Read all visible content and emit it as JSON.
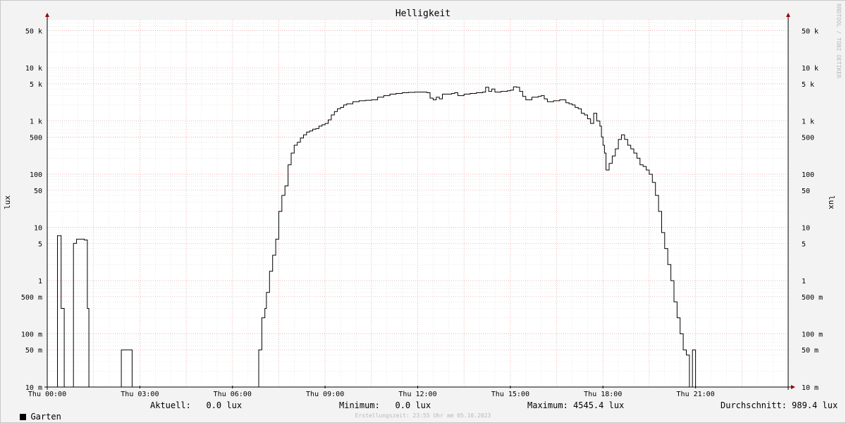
{
  "chart_data": {
    "type": "line",
    "title": "Helligkeit",
    "ylabel": "lux",
    "yscale": "log",
    "ylim": [
      0.01,
      80000
    ],
    "xlim_hours": [
      0,
      24
    ],
    "grid": true,
    "x_ticks": [
      {
        "hour": 0,
        "label": "Thu 00:00"
      },
      {
        "hour": 3,
        "label": "Thu 03:00"
      },
      {
        "hour": 6,
        "label": "Thu 06:00"
      },
      {
        "hour": 9,
        "label": "Thu 09:00"
      },
      {
        "hour": 12,
        "label": "Thu 12:00"
      },
      {
        "hour": 15,
        "label": "Thu 15:00"
      },
      {
        "hour": 18,
        "label": "Thu 18:00"
      },
      {
        "hour": 21,
        "label": "Thu 21:00"
      }
    ],
    "y_ticks": [
      {
        "value": 50000,
        "label": "50 k"
      },
      {
        "value": 10000,
        "label": "10 k"
      },
      {
        "value": 5000,
        "label": "5 k"
      },
      {
        "value": 1000,
        "label": "1 k"
      },
      {
        "value": 500,
        "label": "500"
      },
      {
        "value": 100,
        "label": "100"
      },
      {
        "value": 50,
        "label": "50"
      },
      {
        "value": 10,
        "label": "10"
      },
      {
        "value": 5,
        "label": "5"
      },
      {
        "value": 1,
        "label": "1"
      },
      {
        "value": 0.5,
        "label": "500 m"
      },
      {
        "value": 0.1,
        "label": "100 m"
      },
      {
        "value": 0.05,
        "label": "50 m"
      },
      {
        "value": 0.01,
        "label": "10 m"
      }
    ],
    "series": [
      {
        "name": "Garten",
        "color": "#000000",
        "points": [
          [
            0.0,
            0.01
          ],
          [
            0.33,
            7
          ],
          [
            0.45,
            0.3
          ],
          [
            0.55,
            0.01
          ],
          [
            0.85,
            5
          ],
          [
            0.95,
            6
          ],
          [
            1.2,
            5.8
          ],
          [
            1.3,
            0.3
          ],
          [
            1.35,
            0.01
          ],
          [
            2.4,
            0.05
          ],
          [
            2.7,
            0.05
          ],
          [
            2.75,
            0.01
          ],
          [
            6.8,
            0.01
          ],
          [
            6.85,
            0.05
          ],
          [
            6.95,
            0.2
          ],
          [
            7.05,
            0.3
          ],
          [
            7.1,
            0.6
          ],
          [
            7.2,
            1.5
          ],
          [
            7.3,
            3
          ],
          [
            7.4,
            6
          ],
          [
            7.5,
            20
          ],
          [
            7.6,
            40
          ],
          [
            7.7,
            60
          ],
          [
            7.8,
            150
          ],
          [
            7.9,
            250
          ],
          [
            8.0,
            350
          ],
          [
            8.1,
            400
          ],
          [
            8.2,
            480
          ],
          [
            8.3,
            550
          ],
          [
            8.4,
            620
          ],
          [
            8.5,
            650
          ],
          [
            8.6,
            700
          ],
          [
            8.7,
            720
          ],
          [
            8.8,
            800
          ],
          [
            8.9,
            850
          ],
          [
            9.0,
            900
          ],
          [
            9.1,
            1050
          ],
          [
            9.2,
            1300
          ],
          [
            9.3,
            1500
          ],
          [
            9.4,
            1700
          ],
          [
            9.5,
            1800
          ],
          [
            9.6,
            2000
          ],
          [
            9.7,
            2100
          ],
          [
            9.9,
            2300
          ],
          [
            10.1,
            2400
          ],
          [
            10.3,
            2450
          ],
          [
            10.5,
            2500
          ],
          [
            10.7,
            2800
          ],
          [
            10.9,
            3000
          ],
          [
            11.1,
            3200
          ],
          [
            11.3,
            3300
          ],
          [
            11.5,
            3400
          ],
          [
            11.7,
            3450
          ],
          [
            11.9,
            3500
          ],
          [
            12.1,
            3500
          ],
          [
            12.3,
            3400
          ],
          [
            12.4,
            2700
          ],
          [
            12.5,
            2500
          ],
          [
            12.6,
            2800
          ],
          [
            12.7,
            2600
          ],
          [
            12.8,
            3200
          ],
          [
            13.0,
            3200
          ],
          [
            13.1,
            3300
          ],
          [
            13.2,
            3400
          ],
          [
            13.3,
            3000
          ],
          [
            13.5,
            3200
          ],
          [
            13.7,
            3300
          ],
          [
            13.9,
            3400
          ],
          [
            14.1,
            3500
          ],
          [
            14.2,
            4300
          ],
          [
            14.3,
            3600
          ],
          [
            14.4,
            4000
          ],
          [
            14.5,
            3500
          ],
          [
            14.7,
            3600
          ],
          [
            14.9,
            3700
          ],
          [
            15.0,
            3800
          ],
          [
            15.1,
            4400
          ],
          [
            15.2,
            4300
          ],
          [
            15.3,
            3600
          ],
          [
            15.4,
            2900
          ],
          [
            15.5,
            2500
          ],
          [
            15.7,
            2800
          ],
          [
            15.9,
            2900
          ],
          [
            16.0,
            3000
          ],
          [
            16.1,
            2600
          ],
          [
            16.2,
            2300
          ],
          [
            16.4,
            2400
          ],
          [
            16.6,
            2500
          ],
          [
            16.8,
            2200
          ],
          [
            16.9,
            2100
          ],
          [
            17.0,
            2000
          ],
          [
            17.1,
            1800
          ],
          [
            17.2,
            1700
          ],
          [
            17.3,
            1400
          ],
          [
            17.4,
            1300
          ],
          [
            17.5,
            1100
          ],
          [
            17.6,
            900
          ],
          [
            17.7,
            1400
          ],
          [
            17.8,
            1000
          ],
          [
            17.9,
            800
          ],
          [
            17.95,
            500
          ],
          [
            18.0,
            350
          ],
          [
            18.05,
            250
          ],
          [
            18.1,
            120
          ],
          [
            18.2,
            160
          ],
          [
            18.3,
            220
          ],
          [
            18.4,
            300
          ],
          [
            18.5,
            450
          ],
          [
            18.6,
            550
          ],
          [
            18.7,
            450
          ],
          [
            18.8,
            350
          ],
          [
            18.9,
            300
          ],
          [
            19.0,
            250
          ],
          [
            19.1,
            200
          ],
          [
            19.2,
            150
          ],
          [
            19.3,
            140
          ],
          [
            19.4,
            120
          ],
          [
            19.5,
            100
          ],
          [
            19.6,
            70
          ],
          [
            19.7,
            40
          ],
          [
            19.8,
            20
          ],
          [
            19.9,
            8
          ],
          [
            20.0,
            4
          ],
          [
            20.1,
            2
          ],
          [
            20.2,
            1
          ],
          [
            20.3,
            0.4
          ],
          [
            20.4,
            0.2
          ],
          [
            20.5,
            0.1
          ],
          [
            20.6,
            0.05
          ],
          [
            20.7,
            0.04
          ],
          [
            20.8,
            0.01
          ],
          [
            20.9,
            0.05
          ],
          [
            20.95,
            0.05
          ],
          [
            21.0,
            0.01
          ],
          [
            24.0,
            0.01
          ]
        ]
      }
    ],
    "legend": [
      {
        "label": "Garten",
        "color": "#000000"
      }
    ]
  },
  "stats": {
    "series_label": "Garten",
    "current": "Aktuell:   0.0 lux",
    "minimum": "Minimum:   0.0 lux",
    "maximum": "Maximum: 4545.4 lux",
    "average": "Durchschnitt: 989.4 lux"
  },
  "footer": "Erstellungszeit: 23:55 Uhr am 05.10.2023",
  "credit": "RRDTOOL / TOBI OETIKER"
}
